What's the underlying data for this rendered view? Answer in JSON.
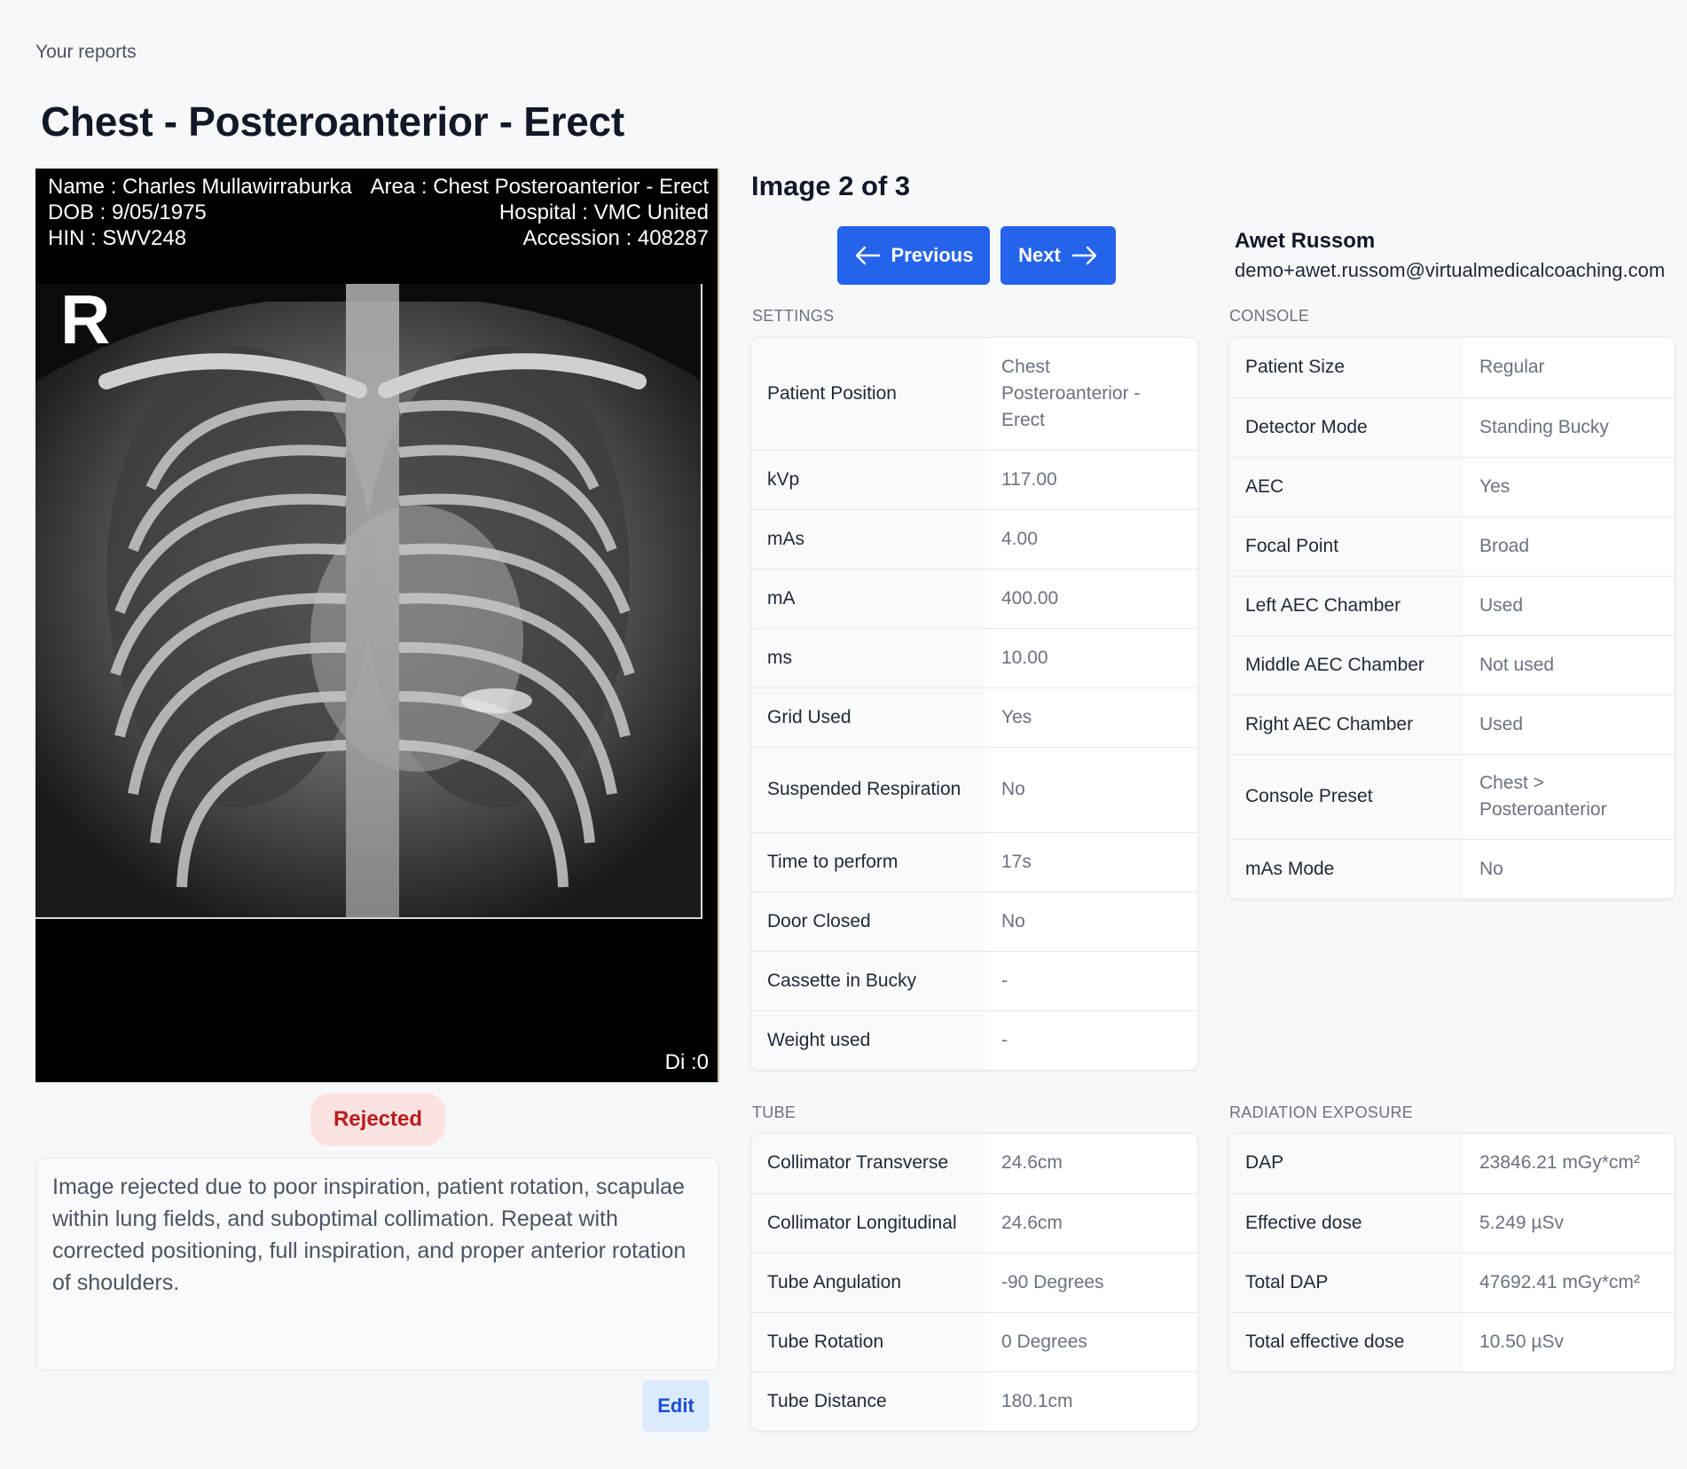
{
  "breadcrumb": "Your reports",
  "title": "Chest - Posteroanterior - Erect",
  "viewer": {
    "name_line": "Name : Charles Mullawirraburka",
    "dob_line": "DOB : 9/05/1975",
    "hin_line": "HIN : SWV248",
    "area_line": "Area : Chest Posteroanterior - Erect",
    "hospital_line": "Hospital : VMC United",
    "accession_line": "Accession : 408287",
    "marker": "R",
    "di_line": "Di :0"
  },
  "status": "Rejected",
  "comment": "Image rejected due to poor inspiration, patient rotation, scapulae within lung fields, and suboptimal collimation. Repeat with corrected positioning, full inspiration, and proper anterior rotation of shoulders.",
  "edit_label": "Edit",
  "image_counter": "Image 2 of 3",
  "nav": {
    "previous": "Previous",
    "next": "Next"
  },
  "user": {
    "name": "Awet Russom",
    "email": "demo+awet.russom@virtualmedicalcoaching.com"
  },
  "settings": {
    "label": "SETTINGS",
    "rows": [
      {
        "k": "Patient Position",
        "v": "Chest Posteroanterior - Erect"
      },
      {
        "k": "kVp",
        "v": "117.00"
      },
      {
        "k": "mAs",
        "v": "4.00"
      },
      {
        "k": "mA",
        "v": "400.00"
      },
      {
        "k": "ms",
        "v": "10.00"
      },
      {
        "k": "Grid Used",
        "v": "Yes"
      },
      {
        "k": "Suspended Respiration",
        "v": "No"
      },
      {
        "k": "Time to perform",
        "v": "17s"
      },
      {
        "k": "Door Closed",
        "v": "No"
      },
      {
        "k": "Cassette in Bucky",
        "v": "-"
      },
      {
        "k": "Weight used",
        "v": "-"
      }
    ]
  },
  "console": {
    "label": "CONSOLE",
    "rows": [
      {
        "k": "Patient Size",
        "v": "Regular"
      },
      {
        "k": "Detector Mode",
        "v": "Standing Bucky"
      },
      {
        "k": "AEC",
        "v": "Yes"
      },
      {
        "k": "Focal Point",
        "v": "Broad"
      },
      {
        "k": "Left AEC Chamber",
        "v": "Used"
      },
      {
        "k": "Middle AEC Chamber",
        "v": "Not used"
      },
      {
        "k": "Right AEC Chamber",
        "v": "Used"
      },
      {
        "k": "Console Preset",
        "v": "Chest > Posteroanterior"
      },
      {
        "k": "mAs Mode",
        "v": "No"
      }
    ]
  },
  "tube": {
    "label": "TUBE",
    "rows": [
      {
        "k": "Collimator Transverse",
        "v": "24.6cm"
      },
      {
        "k": "Collimator Longitudinal",
        "v": "24.6cm"
      },
      {
        "k": "Tube Angulation",
        "v": "-90 Degrees"
      },
      {
        "k": "Tube Rotation",
        "v": "0 Degrees"
      },
      {
        "k": "Tube Distance",
        "v": "180.1cm"
      }
    ]
  },
  "radiation": {
    "label": "RADIATION EXPOSURE",
    "rows": [
      {
        "k": "DAP",
        "v": "23846.21 mGy*cm²"
      },
      {
        "k": "Effective dose",
        "v": "5.249 µSv"
      },
      {
        "k": "Total DAP",
        "v": "47692.41 mGy*cm²"
      },
      {
        "k": "Total effective dose",
        "v": "10.50 µSv"
      }
    ]
  }
}
